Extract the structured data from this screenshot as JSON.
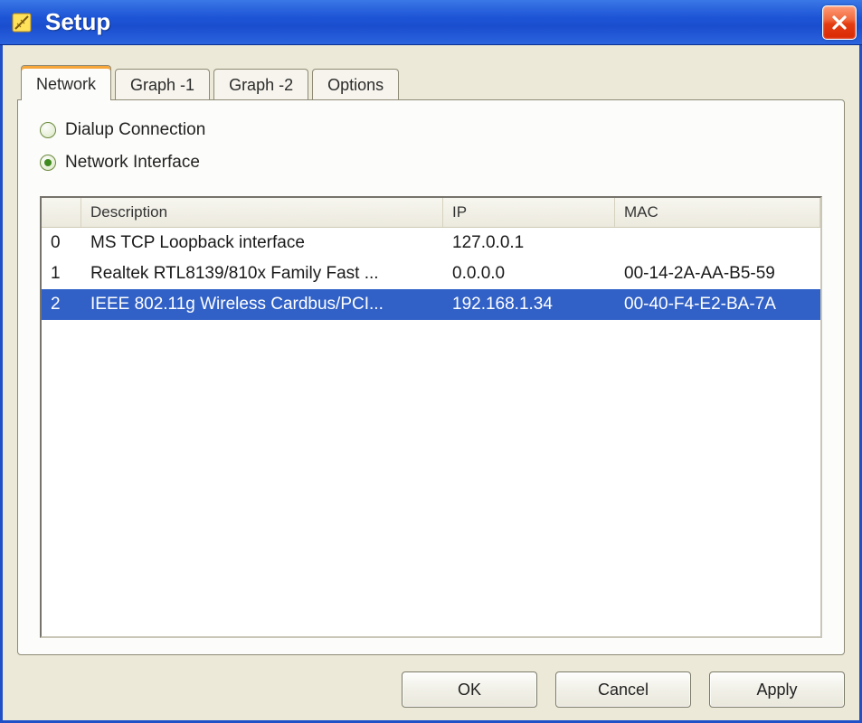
{
  "window": {
    "title": "Setup"
  },
  "tabs": [
    {
      "label": "Network",
      "active": true
    },
    {
      "label": "Graph -1",
      "active": false
    },
    {
      "label": "Graph -2",
      "active": false
    },
    {
      "label": "Options",
      "active": false
    }
  ],
  "connection_options": {
    "dialup": {
      "label": "Dialup Connection",
      "selected": false
    },
    "interface": {
      "label": "Network Interface",
      "selected": true
    }
  },
  "list": {
    "headers": {
      "index": "",
      "description": "Description",
      "ip": "IP",
      "mac": "MAC"
    },
    "rows": [
      {
        "index": "0",
        "description": "MS TCP Loopback interface",
        "ip": "127.0.0.1",
        "mac": "",
        "selected": false
      },
      {
        "index": "1",
        "description": "Realtek RTL8139/810x Family Fast ...",
        "ip": "0.0.0.0",
        "mac": "00-14-2A-AA-B5-59",
        "selected": false
      },
      {
        "index": "2",
        "description": "IEEE 802.11g Wireless Cardbus/PCI...",
        "ip": "192.168.1.34",
        "mac": "00-40-F4-E2-BA-7A",
        "selected": true
      }
    ]
  },
  "buttons": {
    "ok": "OK",
    "cancel": "Cancel",
    "apply": "Apply"
  }
}
